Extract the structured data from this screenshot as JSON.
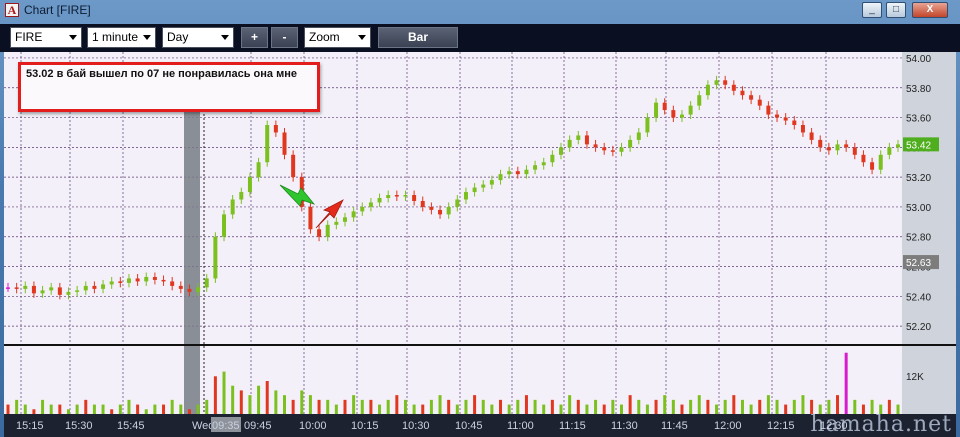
{
  "window": {
    "title": "Chart [FIRE]",
    "icon": "A",
    "controls": [
      "_",
      "□",
      "X"
    ]
  },
  "toolbar": {
    "symbol": "FIRE",
    "interval": "1 minute",
    "range": "Day",
    "zoom_in_label": "+",
    "zoom_out_label": "-",
    "zoom_label": "Zoom",
    "bar_label": "Bar"
  },
  "annotation": {
    "text": "53.02 в бай вышел по 07 не понравилась она мне"
  },
  "watermark": "hamaha.net",
  "chart_data": {
    "type": "candlestick",
    "symbol": "FIRE",
    "price_ticks": [
      "54.00",
      "53.80",
      "53.60",
      "53.40",
      "53.20",
      "53.00",
      "52.80",
      "52.60",
      "52.40",
      "52.20"
    ],
    "price_range": [
      52.08,
      54.04
    ],
    "last_price": "53.42",
    "marker_price": "52.63",
    "volume_tick": "12K",
    "time_ticks": [
      "15:15",
      "15:30",
      "15:45",
      "Wed",
      "09:35",
      "09:45",
      "10:00",
      "10:15",
      "10:30",
      "10:45",
      "11:00",
      "11:15",
      "11:30",
      "11:45",
      "12:00",
      "12:15",
      "12:30"
    ],
    "colors": {
      "up": "#7bc01e",
      "down": "#e0371f",
      "flat": "#d61ccc",
      "last_badge": "#4fae1d",
      "marker_badge": "#7d7d7d",
      "grid": "#5b3a73"
    },
    "price_path": [
      52.46,
      52.45,
      52.47,
      52.42,
      52.44,
      52.46,
      52.41,
      52.43,
      52.44,
      52.47,
      52.45,
      52.48,
      52.5,
      52.49,
      52.52,
      52.5,
      52.53,
      52.51,
      52.5,
      52.47,
      52.45,
      52.43,
      52.46,
      52.52,
      52.8,
      52.95,
      53.05,
      53.1,
      53.2,
      53.3,
      53.55,
      53.5,
      53.35,
      53.2,
      53.0,
      52.85,
      52.8,
      52.88,
      52.9,
      52.93,
      52.97,
      53.0,
      53.03,
      53.06,
      53.08,
      53.07,
      53.08,
      53.04,
      53.0,
      52.98,
      52.95,
      53.0,
      53.05,
      53.1,
      53.13,
      53.15,
      53.18,
      53.22,
      53.24,
      53.22,
      53.25,
      53.28,
      53.3,
      53.35,
      53.4,
      53.45,
      53.48,
      53.42,
      53.4,
      53.38,
      53.37,
      53.4,
      53.45,
      53.5,
      53.6,
      53.7,
      53.65,
      53.6,
      53.62,
      53.68,
      53.75,
      53.82,
      53.85,
      53.82,
      53.78,
      53.75,
      53.72,
      53.68,
      53.62,
      53.6,
      53.58,
      53.55,
      53.5,
      53.45,
      53.4,
      53.38,
      53.42,
      53.4,
      53.35,
      53.3,
      53.25,
      53.35,
      53.4,
      53.42
    ],
    "volume": [
      2,
      3,
      2,
      1,
      3,
      2,
      2,
      1,
      2,
      3,
      2,
      2,
      1,
      2,
      3,
      2,
      1,
      2,
      2,
      3,
      2,
      1,
      2,
      3,
      8,
      9,
      6,
      5,
      4,
      6,
      7,
      5,
      4,
      3,
      5,
      4,
      3,
      3,
      2,
      3,
      4,
      3,
      3,
      2,
      3,
      4,
      3,
      2,
      2,
      3,
      4,
      3,
      2,
      3,
      4,
      3,
      2,
      3,
      2,
      3,
      4,
      3,
      2,
      3,
      2,
      4,
      3,
      2,
      3,
      2,
      3,
      2,
      4,
      3,
      2,
      3,
      4,
      3,
      2,
      3,
      4,
      3,
      2,
      3,
      4,
      3,
      2,
      3,
      4,
      3,
      2,
      3,
      4,
      3,
      2,
      3,
      4,
      13,
      3,
      2,
      3,
      2,
      3,
      2
    ]
  }
}
